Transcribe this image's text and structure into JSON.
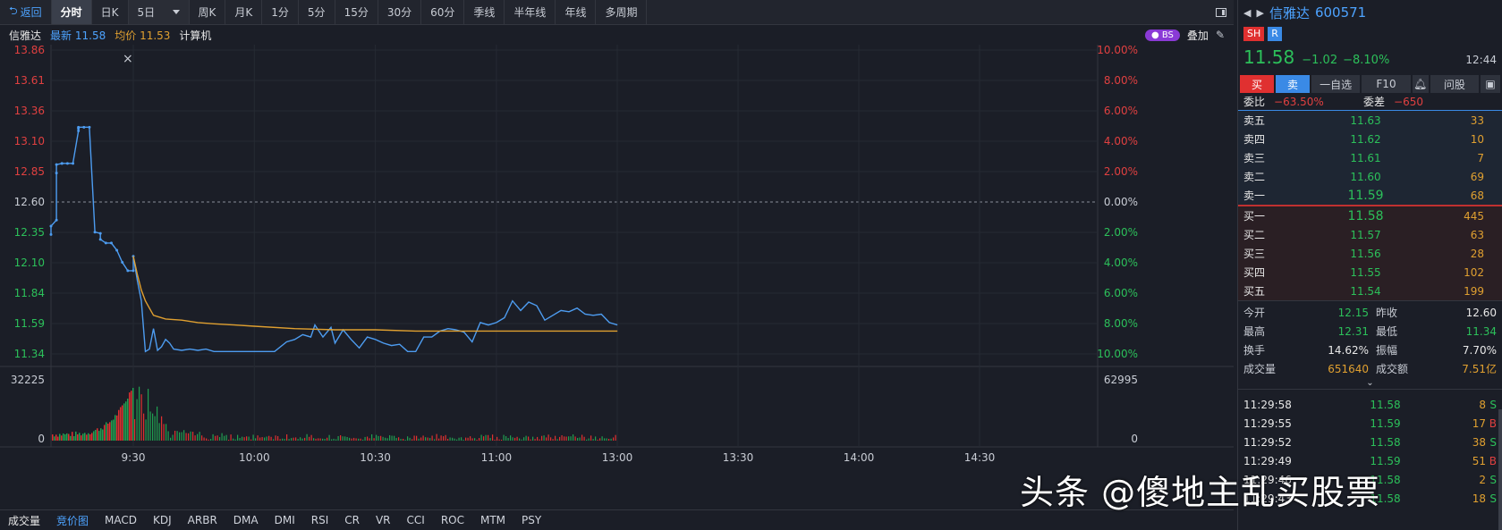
{
  "toolbar": {
    "back": "返回",
    "tabs": [
      "分时",
      "日K"
    ],
    "select_value": "5日",
    "tabs2": [
      "周K",
      "月K",
      "1分",
      "5分",
      "15分",
      "30分",
      "60分",
      "季线",
      "半年线",
      "年线",
      "多周期"
    ]
  },
  "info": {
    "name": "信雅达",
    "latest_label": "最新",
    "latest_value": "11.58",
    "avg_label": "均价",
    "avg_value": "11.53",
    "calc": "计算机",
    "bs_badge": "BS",
    "overlay": "叠加"
  },
  "chart_data": {
    "type": "line",
    "price_axis_labels": [
      "13.86",
      "13.61",
      "13.36",
      "13.10",
      "12.85",
      "12.60",
      "12.35",
      "12.10",
      "11.84",
      "11.59",
      "11.34"
    ],
    "pct_axis_labels": [
      "10.00%",
      "8.00%",
      "6.00%",
      "4.00%",
      "2.00%",
      "0.00%",
      "2.00%",
      "4.00%",
      "6.00%",
      "8.00%",
      "10.00%"
    ],
    "ylim": [
      11.34,
      13.86
    ],
    "prev_close": 12.6,
    "time_labels": [
      "9:30",
      "10:00",
      "10:30",
      "11:00",
      "13:00",
      "13:30",
      "14:00",
      "14:30"
    ],
    "volume_axis_left": [
      "32225",
      "0"
    ],
    "volume_axis_right": [
      "62995",
      "0"
    ],
    "series": [
      {
        "x": [
          "9:15",
          "9:15",
          "9:16",
          "9:16",
          "9:16",
          "9:17",
          "9:17",
          "9:18",
          "9:19",
          "9:20",
          "9:20",
          "9:20",
          "9:21",
          "9:22",
          "9:23",
          "9:24",
          "9:24",
          "9:25",
          "9:26",
          "9:27",
          "9:28",
          "9:29",
          "9:30",
          "9:30"
        ],
        "values": [
          12.33,
          12.4,
          12.45,
          12.84,
          12.91,
          12.92,
          12.92,
          12.92,
          12.92,
          13.19,
          13.21,
          13.22,
          13.22,
          13.22,
          12.35,
          12.34,
          12.29,
          12.26,
          12.26,
          12.2,
          12.1,
          12.03,
          12.03,
          12.15
        ]
      },
      {
        "x": [
          "9:30",
          "9:31",
          "9:32",
          "9:33",
          "9:34",
          "9:35",
          "9:36",
          "9:37",
          "9:38",
          "9:39",
          "9:40",
          "9:42",
          "9:44",
          "9:46",
          "9:48",
          "9:50",
          "9:52",
          "9:55",
          "10:00",
          "10:05",
          "10:08",
          "10:10",
          "10:12",
          "10:14",
          "10:15",
          "10:17",
          "10:19",
          "10:20",
          "10:22",
          "10:24",
          "10:26",
          "10:28",
          "10:30",
          "10:32",
          "10:34",
          "10:36",
          "10:38",
          "10:40",
          "10:42",
          "10:44",
          "10:46",
          "10:48",
          "10:50",
          "10:52",
          "10:54",
          "10:56",
          "10:58",
          "11:00",
          "11:02",
          "11:04",
          "11:06",
          "11:08",
          "11:10",
          "11:12",
          "11:14",
          "11:16",
          "11:18",
          "11:20",
          "11:22",
          "11:24",
          "11:26",
          "11:28",
          "11:30"
        ],
        "values": [
          12.15,
          11.95,
          11.78,
          11.36,
          11.38,
          11.55,
          11.37,
          11.4,
          11.46,
          11.43,
          11.38,
          11.37,
          11.38,
          11.37,
          11.38,
          11.36,
          11.36,
          11.36,
          11.36,
          11.36,
          11.44,
          11.46,
          11.5,
          11.48,
          11.58,
          11.48,
          11.56,
          11.43,
          11.54,
          11.46,
          11.39,
          11.48,
          11.46,
          11.43,
          11.41,
          11.42,
          11.36,
          11.36,
          11.48,
          11.48,
          11.53,
          11.55,
          11.54,
          11.52,
          11.44,
          11.6,
          11.58,
          11.6,
          11.64,
          11.78,
          11.7,
          11.77,
          11.74,
          11.62,
          11.66,
          11.7,
          11.69,
          11.72,
          11.67,
          11.66,
          11.67,
          11.6,
          11.58
        ]
      },
      {
        "x": [
          "9:30",
          "9:31",
          "9:32",
          "9:33",
          "9:34",
          "9:35",
          "9:38",
          "9:42",
          "9:46",
          "9:50",
          "9:55",
          "10:00",
          "10:10",
          "10:20",
          "10:30",
          "10:40",
          "10:50",
          "11:00",
          "11:10",
          "11:20",
          "11:30"
        ],
        "values": [
          12.15,
          12.0,
          11.87,
          11.78,
          11.72,
          11.66,
          11.63,
          11.62,
          11.6,
          11.59,
          11.58,
          11.57,
          11.55,
          11.54,
          11.54,
          11.53,
          11.53,
          11.53,
          11.53,
          11.53,
          11.53
        ]
      }
    ]
  },
  "indicators": [
    "成交量",
    "竞价图",
    "MACD",
    "KDJ",
    "ARBR",
    "DMA",
    "DMI",
    "RSI",
    "CR",
    "VR",
    "CCI",
    "ROC",
    "MTM",
    "PSY"
  ],
  "panel": {
    "name": "信雅达",
    "code": "600571",
    "badge_sh": "SH",
    "badge_r": "R",
    "price": "11.58",
    "change": "−1.02",
    "change_pct": "−8.10%",
    "time": "12:44",
    "actions": [
      "买",
      "卖",
      "一自选",
      "F10",
      "问股"
    ],
    "ratio_label": "委比",
    "ratio_value": "−63.50%",
    "diff_label": "委差",
    "diff_value": "−650",
    "sells": [
      {
        "k": "卖五",
        "p": "11.63",
        "q": "33"
      },
      {
        "k": "卖四",
        "p": "11.62",
        "q": "10"
      },
      {
        "k": "卖三",
        "p": "11.61",
        "q": "7"
      },
      {
        "k": "卖二",
        "p": "11.60",
        "q": "69"
      },
      {
        "k": "卖一",
        "p": "11.59",
        "q": "68"
      }
    ],
    "buys": [
      {
        "k": "买一",
        "p": "11.58",
        "q": "445"
      },
      {
        "k": "买二",
        "p": "11.57",
        "q": "63"
      },
      {
        "k": "买三",
        "p": "11.56",
        "q": "28"
      },
      {
        "k": "买四",
        "p": "11.55",
        "q": "102"
      },
      {
        "k": "买五",
        "p": "11.54",
        "q": "199"
      }
    ],
    "stats": [
      {
        "k": "今开",
        "v": "12.15",
        "k2": "昨收",
        "v2": "12.60"
      },
      {
        "k": "最高",
        "v": "12.31",
        "k2": "最低",
        "v2": "11.34"
      },
      {
        "k": "换手",
        "v": "14.62%",
        "k2": "振幅",
        "v2": "7.70%"
      },
      {
        "k": "成交量",
        "v": "651640",
        "k2": "成交额",
        "v2": "7.51亿"
      }
    ],
    "ticks": [
      {
        "t": "11:29:58",
        "p": "11.58",
        "q": "8",
        "d": "S"
      },
      {
        "t": "11:29:55",
        "p": "11.59",
        "q": "17",
        "d": "B"
      },
      {
        "t": "11:29:52",
        "p": "11.58",
        "q": "38",
        "d": "S"
      },
      {
        "t": "11:29:49",
        "p": "11.59",
        "q": "51",
        "d": "B"
      },
      {
        "t": "11:29:46",
        "p": "11.58",
        "q": "2",
        "d": "S"
      },
      {
        "t": "11:29:43",
        "p": "11.58",
        "q": "18",
        "d": "S"
      }
    ]
  },
  "watermark": "头条 @傻地主乱买股票"
}
